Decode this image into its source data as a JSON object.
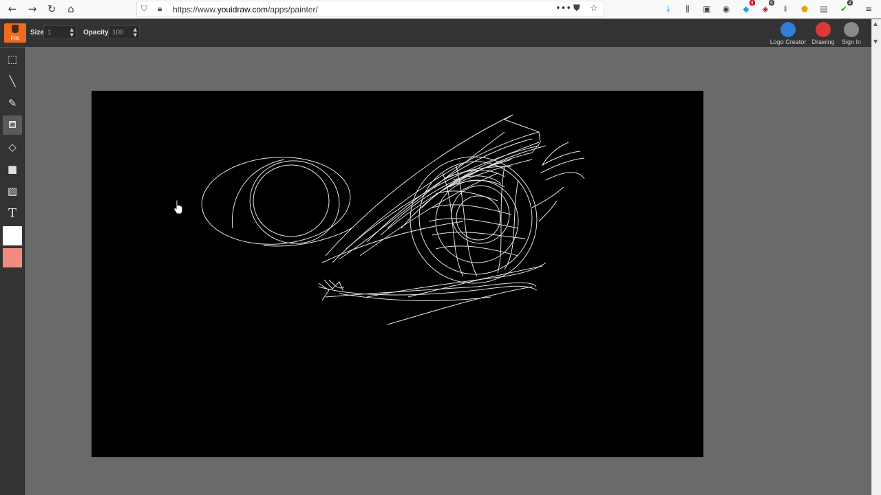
{
  "browser": {
    "url_prefix": "https://www.",
    "url_host": "youidraw.com",
    "url_path": "/apps/painter/",
    "ext_badge_1": "4",
    "ext_badge_2": "4",
    "ext_badge_3": "2"
  },
  "toolbar": {
    "file_label": "File",
    "size_label": "Size:",
    "size_value": "1",
    "opacity_label": "Opacity:",
    "opacity_value": "100",
    "logo_creator_label": "Logo Creator",
    "drawing_label": "Drawing",
    "sign_in_label": "Sign In"
  },
  "tools": {
    "text_tool_glyph": "T"
  },
  "colors": {
    "primary_color": "#ffffff",
    "secondary_color": "#f28b82",
    "accent": "#ef6c1f",
    "canvas_bg": "#000000",
    "workspace_bg": "#6a6a6a"
  }
}
